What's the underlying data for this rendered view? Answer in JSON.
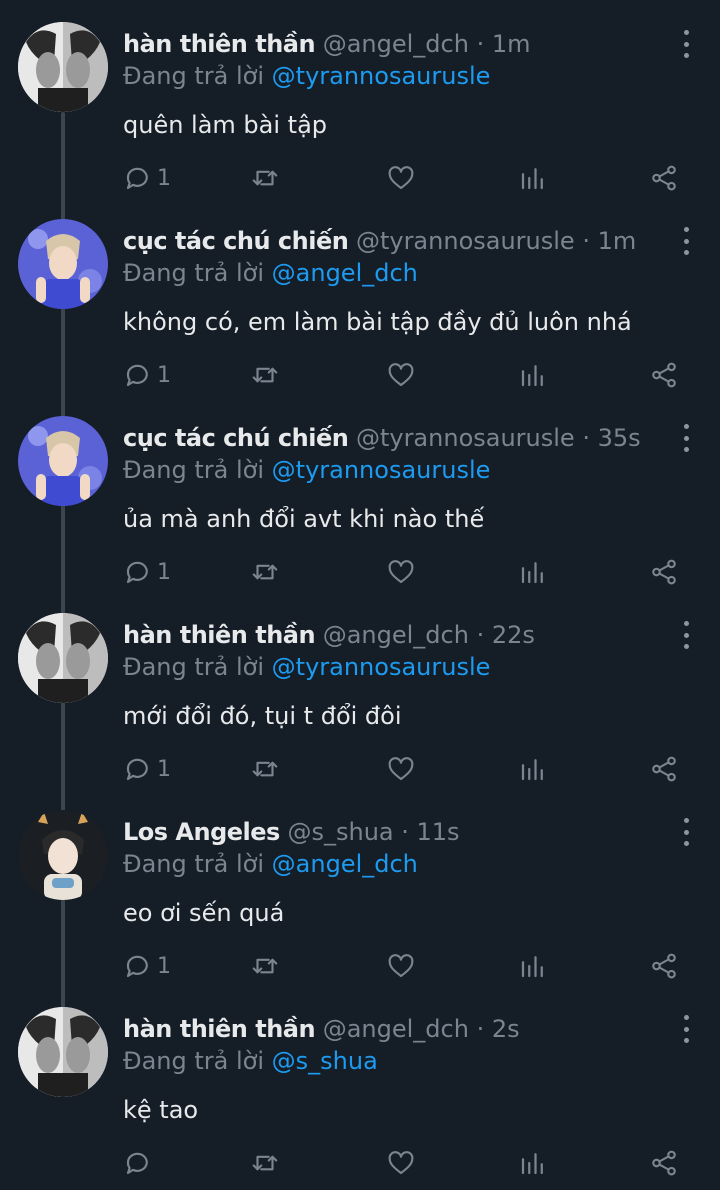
{
  "colors": {
    "background": "#151d27",
    "text": "#e7e9ea",
    "muted": "#7a858f",
    "mention": "#1d9bf0",
    "thread_line": "#3b4550"
  },
  "reply_prefix": "Đang trả lời",
  "tweets": [
    {
      "avatar": "mono-portrait-avatar",
      "name": "hàn thiên thần",
      "handle": "@angel_dch",
      "time": "1m",
      "mention": "@tyrannosaurusle",
      "text": "quên làm bài tập",
      "reply_count": "1"
    },
    {
      "avatar": "blue-portrait-avatar",
      "name": "cục tác chú chiến",
      "handle": "@tyrannosaurusle",
      "time": "1m",
      "mention": "@angel_dch",
      "text": "không có, em làm bài tập đầy đủ luôn nhá",
      "reply_count": "1"
    },
    {
      "avatar": "blue-portrait-avatar",
      "name": "cục tác chú chiến",
      "handle": "@tyrannosaurusle",
      "time": "35s",
      "mention": "@tyrannosaurusle",
      "text": "ủa mà anh đổi avt khi nào thế",
      "reply_count": "1"
    },
    {
      "avatar": "mono-portrait-avatar",
      "name": "hàn thiên thần",
      "handle": "@angel_dch",
      "time": "22s",
      "mention": "@tyrannosaurusle",
      "text": "mới đổi đó, tụi t đổi đôi",
      "reply_count": "1"
    },
    {
      "avatar": "dark-portrait-avatar",
      "name": "Los Angeles",
      "handle": "@s_shua",
      "time": "11s",
      "mention": "@angel_dch",
      "text": "eo ơi sến quá",
      "reply_count": "1"
    },
    {
      "avatar": "mono-portrait-avatar",
      "name": "hàn thiên thần",
      "handle": "@angel_dch",
      "time": "2s",
      "mention": "@s_shua",
      "text": "kệ tao",
      "reply_count": ""
    }
  ],
  "icons": {
    "reply": "reply-icon",
    "retweet": "retweet-icon",
    "like": "heart-icon",
    "stats": "stats-icon",
    "share": "share-icon",
    "more": "more-vertical-icon"
  }
}
